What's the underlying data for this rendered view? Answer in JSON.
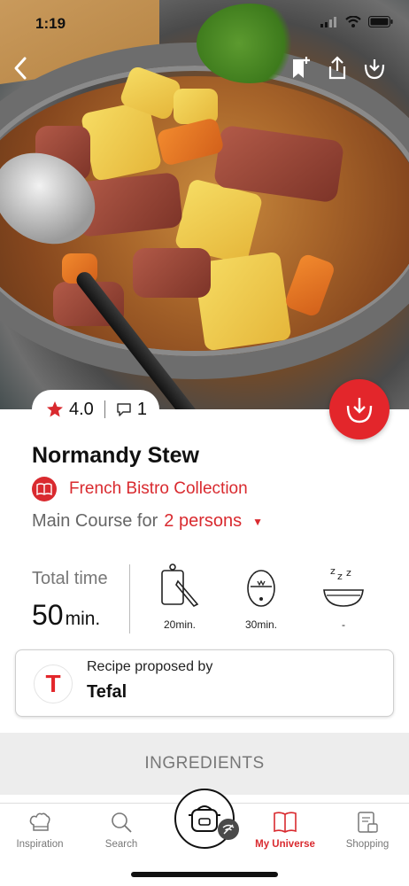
{
  "status_bar": {
    "time": "1:19"
  },
  "hero": {
    "back_icon": "chevron-left-icon",
    "actions": [
      {
        "icon": "bookmark-add-icon"
      },
      {
        "icon": "share-icon"
      },
      {
        "icon": "pot-download-icon"
      }
    ]
  },
  "rating": {
    "value": "4.0",
    "comments": "1"
  },
  "recipe": {
    "title": "Normandy Stew",
    "collection": "French Bistro Collection",
    "servings_prefix": "Main Course for",
    "servings_value": "2 persons"
  },
  "timing": {
    "total_label": "Total time",
    "total_value": "50",
    "total_unit": "min.",
    "steps": [
      {
        "icon": "cutting-board-knife-icon",
        "value": "20",
        "unit": "min."
      },
      {
        "icon": "egg-timer-icon",
        "value": "30",
        "unit": "min."
      },
      {
        "icon": "resting-bowl-icon",
        "value": "-",
        "unit": ""
      }
    ]
  },
  "proposed": {
    "label": "Recipe proposed by",
    "name": "Tefal",
    "logo_letter": "T"
  },
  "ingredients": {
    "label": "INGREDIENTS"
  },
  "tabs": [
    {
      "label": "Inspiration",
      "icon": "chef-hat-icon",
      "active": false
    },
    {
      "label": "Search",
      "icon": "search-icon",
      "active": false
    },
    {
      "label": "My Universe",
      "icon": "book-icon",
      "active": true
    },
    {
      "label": "Shopping",
      "icon": "shopping-list-icon",
      "active": false
    }
  ],
  "colors": {
    "accent": "#d92a2f",
    "fab": "#e3262b"
  }
}
